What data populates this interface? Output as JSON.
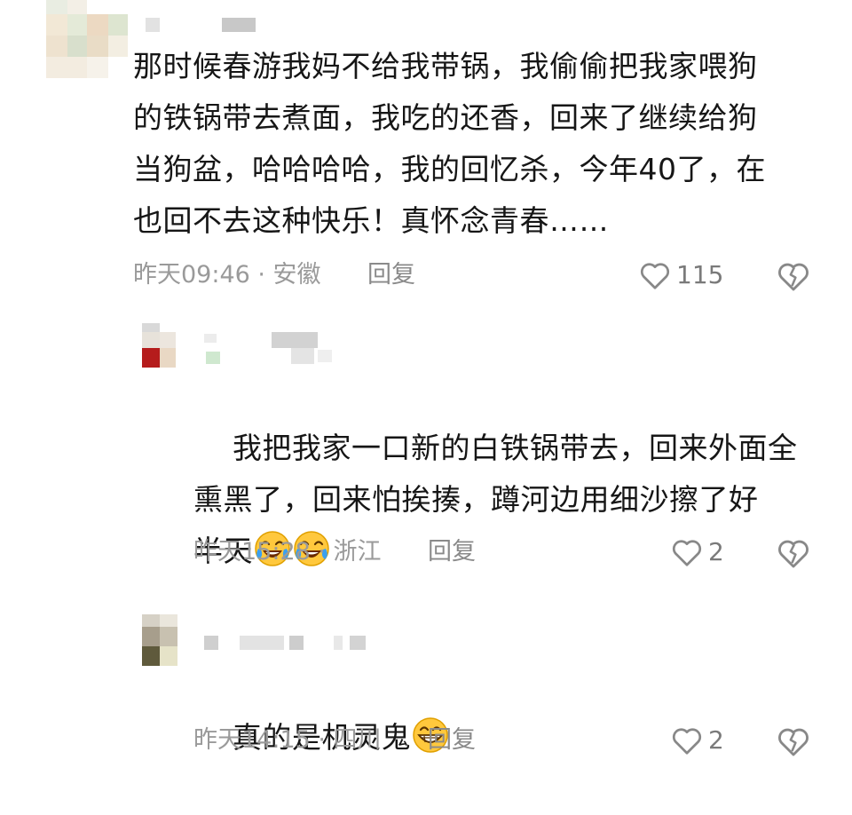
{
  "comments": [
    {
      "text": "那时候春游我妈不给我带锅，我偷偷把我家喂狗\n的铁锅带去煮面，我吃的还香，回来了继续给狗\n当狗盆，哈哈哈哈，我的回忆杀，今年40了，在\n也回不去这种快乐！真怀念青春……",
      "time_location": "昨天09:46 · 安徽",
      "reply_label": "回复",
      "likes": "115"
    },
    {
      "text": "我把我家一口新的白铁锅带去，回来外面全\n熏黑了，回来怕挨揍，蹲河边用细沙擦了好\n半天",
      "emoji_count": 2,
      "time_location": "昨天15:28 · 浙江",
      "reply_label": "回复",
      "likes": "2"
    },
    {
      "text": "真的是机灵鬼",
      "time_location": "昨天14:15 · 四川",
      "reply_label": "回复",
      "likes": "2"
    }
  ],
  "colors": {
    "text": "#161616",
    "meta": "#9a9a9a",
    "icon": "#888888"
  },
  "icons": [
    "heart-icon",
    "broken-heart-icon",
    "laughing-crying-emoji",
    "grinning-emoji"
  ]
}
